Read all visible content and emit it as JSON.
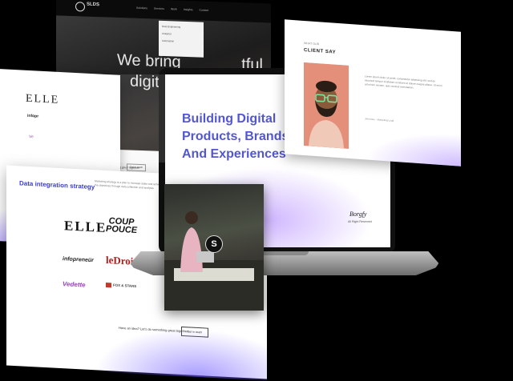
{
  "hero": {
    "logo": "SLDS",
    "nav": [
      "Solutions",
      "Services",
      "Work",
      "Insights",
      "Contact"
    ],
    "headline_line1": "We bring",
    "headline_line1b": "tful",
    "headline_line2": "digit",
    "dropdown_items": [
      "Data Engineering",
      "Analytics",
      "Automation"
    ],
    "cta_text": "Have an idea? Let's do something great together!",
    "cta_button": "Get in touch"
  },
  "brands": {
    "b1": "ELLE",
    "b2": "infopr",
    "b3": "Ve"
  },
  "data_page": {
    "title": "Data integration strategy",
    "paragraph": "Marketing strategy is a plan to increase sales and achieve the objectives through data collection and analysis.",
    "logos": {
      "elle": "ELLE",
      "coup_line1": "COUP",
      "coup_line2": "POUCE",
      "infopreneur": "infopreneür",
      "ledroit": "leDroit",
      "vedette": "Vedette",
      "fox": "FOX & STARS"
    },
    "footer_text": "Have an idea? Let's do something great together!",
    "footer_button": "Get in touch"
  },
  "laptop": {
    "headline": "Building Digital Products, Brands And Experiences",
    "signature": "Borgfy",
    "signature_sub": "All Right Reserved"
  },
  "client": {
    "label": "WHAT OUR",
    "title": "CLIENT SAY",
    "text": "Lorem ipsum dolor sit amet, consectetur adipiscing elit, sed do eiusmod tempor incididunt ut labore et dolore magna aliqua. Ut enim ad minim veniam, quis nostrud exercitation.",
    "meta": "John Doe  ·  Marketing Lead"
  },
  "video": {
    "badge": "S"
  },
  "colors": {
    "accent": "#3b3fc9",
    "bg": "#000000"
  }
}
